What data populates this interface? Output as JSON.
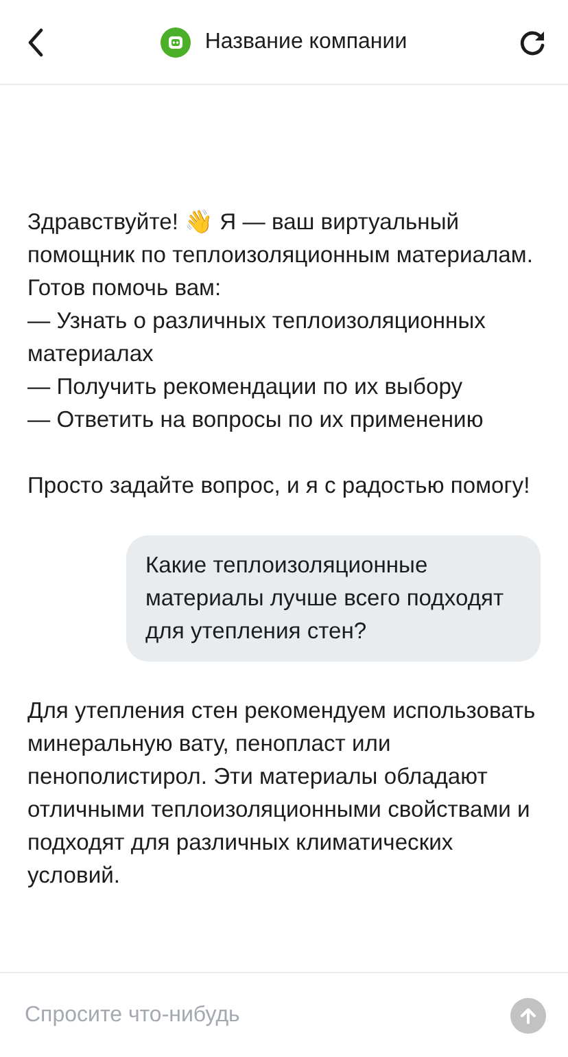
{
  "header": {
    "title": "Название компании"
  },
  "messages": [
    {
      "kind": "bot",
      "paragraphs": [
        [
          "Здравствуйте! 👋 Я — ваш виртуальный помощник по теплоизоляционным материалам.",
          "Готов помочь вам:",
          "— Узнать о различных теплоизоляционных материалах",
          "— Получить рекомендации по их выбору",
          "— Ответить на вопросы по их применению"
        ],
        [
          "Просто задайте вопрос, и я с радостью помогу!"
        ]
      ]
    },
    {
      "kind": "user",
      "paragraphs": [
        [
          "Какие теплоизоляционные материалы лучше всего подходят для утепления стен?"
        ]
      ]
    },
    {
      "kind": "bot",
      "paragraphs": [
        [
          "Для утепления стен рекомендуем использовать минеральную вату, пенопласт или пенополистирол. Эти материалы обладают отличными теплоизоляционными свойствами и подходят для различных климатических условий."
        ]
      ]
    }
  ],
  "composer": {
    "placeholder": "Спросите что-нибудь",
    "send_disabled": true
  }
}
